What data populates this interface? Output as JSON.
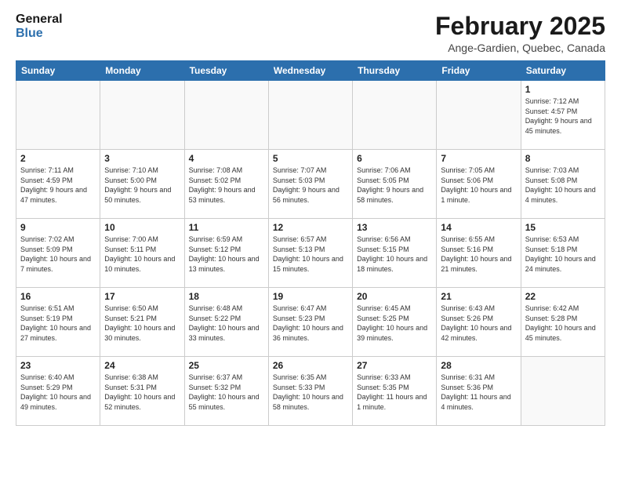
{
  "header": {
    "logo_general": "General",
    "logo_blue": "Blue",
    "month_title": "February 2025",
    "subtitle": "Ange-Gardien, Quebec, Canada"
  },
  "weekdays": [
    "Sunday",
    "Monday",
    "Tuesday",
    "Wednesday",
    "Thursday",
    "Friday",
    "Saturday"
  ],
  "weeks": [
    [
      {
        "day": "",
        "info": ""
      },
      {
        "day": "",
        "info": ""
      },
      {
        "day": "",
        "info": ""
      },
      {
        "day": "",
        "info": ""
      },
      {
        "day": "",
        "info": ""
      },
      {
        "day": "",
        "info": ""
      },
      {
        "day": "1",
        "info": "Sunrise: 7:12 AM\nSunset: 4:57 PM\nDaylight: 9 hours and 45 minutes."
      }
    ],
    [
      {
        "day": "2",
        "info": "Sunrise: 7:11 AM\nSunset: 4:59 PM\nDaylight: 9 hours and 47 minutes."
      },
      {
        "day": "3",
        "info": "Sunrise: 7:10 AM\nSunset: 5:00 PM\nDaylight: 9 hours and 50 minutes."
      },
      {
        "day": "4",
        "info": "Sunrise: 7:08 AM\nSunset: 5:02 PM\nDaylight: 9 hours and 53 minutes."
      },
      {
        "day": "5",
        "info": "Sunrise: 7:07 AM\nSunset: 5:03 PM\nDaylight: 9 hours and 56 minutes."
      },
      {
        "day": "6",
        "info": "Sunrise: 7:06 AM\nSunset: 5:05 PM\nDaylight: 9 hours and 58 minutes."
      },
      {
        "day": "7",
        "info": "Sunrise: 7:05 AM\nSunset: 5:06 PM\nDaylight: 10 hours and 1 minute."
      },
      {
        "day": "8",
        "info": "Sunrise: 7:03 AM\nSunset: 5:08 PM\nDaylight: 10 hours and 4 minutes."
      }
    ],
    [
      {
        "day": "9",
        "info": "Sunrise: 7:02 AM\nSunset: 5:09 PM\nDaylight: 10 hours and 7 minutes."
      },
      {
        "day": "10",
        "info": "Sunrise: 7:00 AM\nSunset: 5:11 PM\nDaylight: 10 hours and 10 minutes."
      },
      {
        "day": "11",
        "info": "Sunrise: 6:59 AM\nSunset: 5:12 PM\nDaylight: 10 hours and 13 minutes."
      },
      {
        "day": "12",
        "info": "Sunrise: 6:57 AM\nSunset: 5:13 PM\nDaylight: 10 hours and 15 minutes."
      },
      {
        "day": "13",
        "info": "Sunrise: 6:56 AM\nSunset: 5:15 PM\nDaylight: 10 hours and 18 minutes."
      },
      {
        "day": "14",
        "info": "Sunrise: 6:55 AM\nSunset: 5:16 PM\nDaylight: 10 hours and 21 minutes."
      },
      {
        "day": "15",
        "info": "Sunrise: 6:53 AM\nSunset: 5:18 PM\nDaylight: 10 hours and 24 minutes."
      }
    ],
    [
      {
        "day": "16",
        "info": "Sunrise: 6:51 AM\nSunset: 5:19 PM\nDaylight: 10 hours and 27 minutes."
      },
      {
        "day": "17",
        "info": "Sunrise: 6:50 AM\nSunset: 5:21 PM\nDaylight: 10 hours and 30 minutes."
      },
      {
        "day": "18",
        "info": "Sunrise: 6:48 AM\nSunset: 5:22 PM\nDaylight: 10 hours and 33 minutes."
      },
      {
        "day": "19",
        "info": "Sunrise: 6:47 AM\nSunset: 5:23 PM\nDaylight: 10 hours and 36 minutes."
      },
      {
        "day": "20",
        "info": "Sunrise: 6:45 AM\nSunset: 5:25 PM\nDaylight: 10 hours and 39 minutes."
      },
      {
        "day": "21",
        "info": "Sunrise: 6:43 AM\nSunset: 5:26 PM\nDaylight: 10 hours and 42 minutes."
      },
      {
        "day": "22",
        "info": "Sunrise: 6:42 AM\nSunset: 5:28 PM\nDaylight: 10 hours and 45 minutes."
      }
    ],
    [
      {
        "day": "23",
        "info": "Sunrise: 6:40 AM\nSunset: 5:29 PM\nDaylight: 10 hours and 49 minutes."
      },
      {
        "day": "24",
        "info": "Sunrise: 6:38 AM\nSunset: 5:31 PM\nDaylight: 10 hours and 52 minutes."
      },
      {
        "day": "25",
        "info": "Sunrise: 6:37 AM\nSunset: 5:32 PM\nDaylight: 10 hours and 55 minutes."
      },
      {
        "day": "26",
        "info": "Sunrise: 6:35 AM\nSunset: 5:33 PM\nDaylight: 10 hours and 58 minutes."
      },
      {
        "day": "27",
        "info": "Sunrise: 6:33 AM\nSunset: 5:35 PM\nDaylight: 11 hours and 1 minute."
      },
      {
        "day": "28",
        "info": "Sunrise: 6:31 AM\nSunset: 5:36 PM\nDaylight: 11 hours and 4 minutes."
      },
      {
        "day": "",
        "info": ""
      }
    ]
  ]
}
